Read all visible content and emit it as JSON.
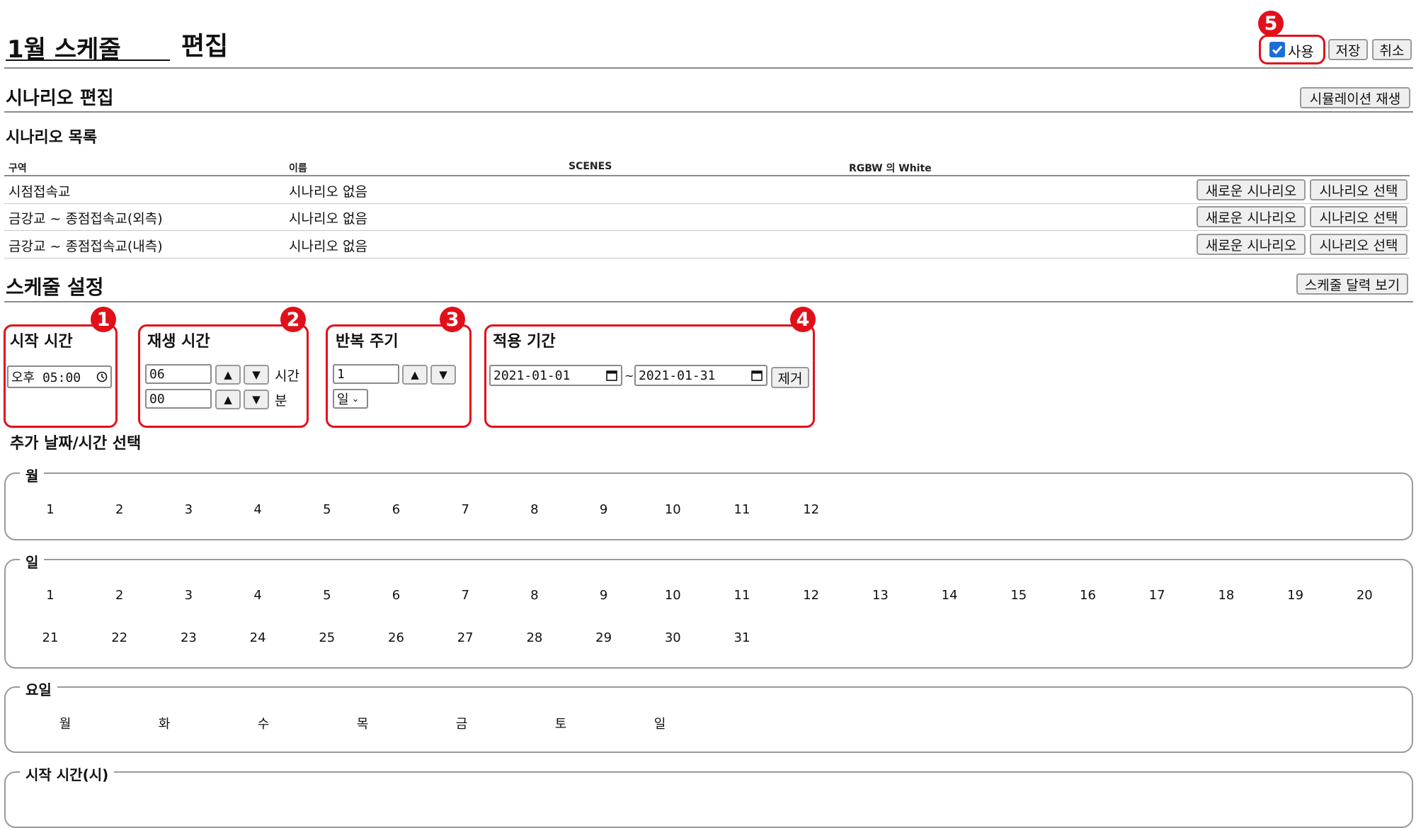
{
  "header": {
    "schedule_name": "1월 스케줄",
    "title_suffix": "편집",
    "use_label": "사용",
    "use_checked": true,
    "save_label": "저장",
    "cancel_label": "취소"
  },
  "scenario_edit": {
    "title": "시나리오 편집",
    "simulate_button": "시뮬레이션 재생",
    "list_title": "시나리오 목록",
    "columns": [
      "구역",
      "이름",
      "SCENES",
      "RGBW 의 White"
    ],
    "rows": [
      {
        "zone": "시점접속교",
        "name": "시나리오 없음",
        "new_btn": "새로운 시나리오",
        "select_btn": "시나리오 선택"
      },
      {
        "zone": "금강교 ~ 종점접속교(외측)",
        "name": "시나리오 없음",
        "new_btn": "새로운 시나리오",
        "select_btn": "시나리오 선택"
      },
      {
        "zone": "금강교 ~ 종점접속교(내측)",
        "name": "시나리오 없음",
        "new_btn": "새로운 시나리오",
        "select_btn": "시나리오 선택"
      }
    ]
  },
  "schedule_settings": {
    "title": "스케줄 설정",
    "calendar_button": "스케줄 달력 보기",
    "start_time": {
      "label": "시작 시간",
      "value": "오후 05:00"
    },
    "play_time": {
      "label": "재생 시간",
      "hours": "06",
      "hours_unit": "시간",
      "minutes": "00",
      "minutes_unit": "분"
    },
    "repeat": {
      "label": "반복 주기",
      "value": "1",
      "unit": "일"
    },
    "period": {
      "label": "적용 기간",
      "start": "2021-01-01",
      "separator": "~",
      "end": "2021-01-31",
      "remove_button": "제거"
    },
    "badges": [
      "1",
      "2",
      "3",
      "4",
      "5"
    ]
  },
  "extra": {
    "title": "추가 날짜/시간 선택",
    "months_legend": "월",
    "months": [
      "1",
      "2",
      "3",
      "4",
      "5",
      "6",
      "7",
      "8",
      "9",
      "10",
      "11",
      "12"
    ],
    "days_legend": "일",
    "days_row1": [
      "1",
      "2",
      "3",
      "4",
      "5",
      "6",
      "7",
      "8",
      "9",
      "10",
      "11",
      "12",
      "13",
      "14",
      "15",
      "16",
      "17",
      "18",
      "19",
      "20"
    ],
    "days_row2": [
      "21",
      "22",
      "23",
      "24",
      "25",
      "26",
      "27",
      "28",
      "29",
      "30",
      "31"
    ],
    "weekday_legend": "요일",
    "weekdays": [
      "월",
      "화",
      "수",
      "목",
      "금",
      "토",
      "일"
    ],
    "start_hour_legend": "시작 시간(시)"
  },
  "colors": {
    "annotation_red": "#e0101b",
    "check_blue": "#1a6fd6"
  }
}
